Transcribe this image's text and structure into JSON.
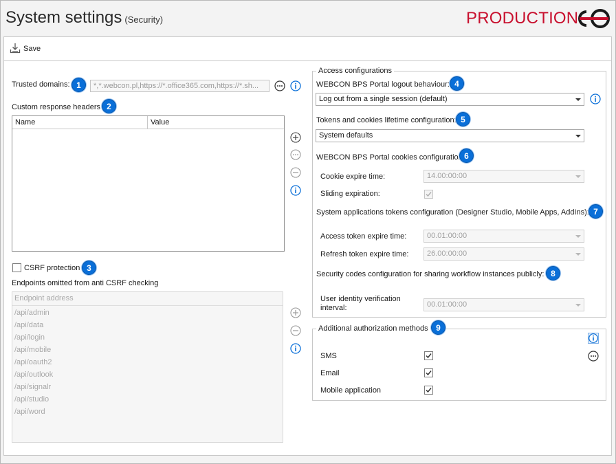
{
  "header": {
    "title": "System settings",
    "subtitle": "(Security)",
    "environment": "PRODUCTION",
    "environment_color": "#c8102e"
  },
  "toolbar": {
    "save_label": "Save",
    "save_icon": "save-icon"
  },
  "left": {
    "trusted_domains_label": "Trusted domains:",
    "trusted_domains_value": "*,*.webcon.pl,https://*.office365.com,https://*.sh...",
    "custom_headers_label": "Custom response headers",
    "custom_headers_columns": [
      "Name",
      "Value"
    ],
    "csrf_label": "CSRF protection",
    "csrf_checked": false,
    "endpoints_label": "Endpoints omitted from anti CSRF checking",
    "endpoints_header": "Endpoint address",
    "endpoints": [
      "/api/admin",
      "/api/data",
      "/api/login",
      "/api/mobile",
      "/api/oauth2",
      "/api/outlook",
      "/api/signalr",
      "/api/studio",
      "/api/word"
    ]
  },
  "access": {
    "group_title": "Access configurations",
    "logout_label": "WEBCON BPS Portal logout behaviour:",
    "logout_value": "Log out from a single session (default)",
    "tokens_label": "Tokens and cookies lifetime configuration:",
    "tokens_value": "System defaults",
    "cookies_label": "WEBCON BPS Portal cookies configuration:",
    "cookie_expire_label": "Cookie expire time:",
    "cookie_expire_value": "14.00:00:00",
    "sliding_label": "Sliding expiration:",
    "sliding_checked": true,
    "sysapp_label": "System applications tokens configuration (Designer Studio, Mobile Apps, AddIns):",
    "access_token_label": "Access token expire time:",
    "access_token_value": "00.01:00:00",
    "refresh_token_label": "Refresh token expire time:",
    "refresh_token_value": "26.00:00:00",
    "security_codes_label": "Security codes configuration for sharing workflow instances publicly:",
    "identity_label_line1": "User identity verification",
    "identity_label_line2": "interval:",
    "identity_value": "00.01:00:00"
  },
  "auth": {
    "group_title": "Additional authorization methods",
    "methods": [
      {
        "label": "SMS",
        "checked": true
      },
      {
        "label": "Email",
        "checked": true
      },
      {
        "label": "Mobile application",
        "checked": true
      }
    ]
  },
  "badges": [
    "1",
    "2",
    "3",
    "4",
    "5",
    "6",
    "7",
    "8",
    "9"
  ],
  "colors": {
    "badge": "#0a6fd8",
    "info": "#0a6fd8",
    "accent_red": "#c8102e"
  }
}
